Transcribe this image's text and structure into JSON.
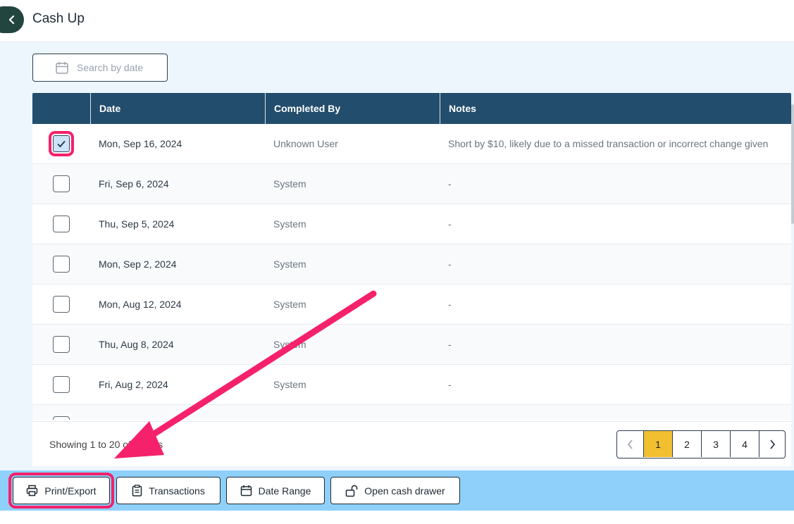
{
  "header": {
    "title": "Cash Up"
  },
  "search": {
    "placeholder": "Search by date"
  },
  "table": {
    "columns": [
      "",
      "Date",
      "Completed By",
      "Notes"
    ],
    "rows": [
      {
        "checked": true,
        "date": "Mon, Sep 16, 2024",
        "completed_by": "Unknown User",
        "notes": "Short by $10, likely due to a missed transaction or incorrect change given"
      },
      {
        "checked": false,
        "date": "Fri, Sep 6, 2024",
        "completed_by": "System",
        "notes": "-"
      },
      {
        "checked": false,
        "date": "Thu, Sep 5, 2024",
        "completed_by": "System",
        "notes": "-"
      },
      {
        "checked": false,
        "date": "Mon, Sep 2, 2024",
        "completed_by": "System",
        "notes": "-"
      },
      {
        "checked": false,
        "date": "Mon, Aug 12, 2024",
        "completed_by": "System",
        "notes": "-"
      },
      {
        "checked": false,
        "date": "Thu, Aug 8, 2024",
        "completed_by": "System",
        "notes": "-"
      },
      {
        "checked": false,
        "date": "Fri, Aug 2, 2024",
        "completed_by": "System",
        "notes": "-"
      },
      {
        "checked": false,
        "date": "",
        "completed_by": "",
        "notes": ""
      }
    ]
  },
  "pagination": {
    "showing_text": "Showing 1 to 20 of results",
    "pages": [
      "1",
      "2",
      "3",
      "4"
    ],
    "active_page": "1"
  },
  "actions": {
    "print_export": "Print/Export",
    "transactions": "Transactions",
    "date_range": "Date Range",
    "open_cash_drawer": "Open cash drawer"
  },
  "colors": {
    "header_bg": "#234d6d",
    "active_page": "#f2bf30",
    "bottom_bar": "#8fd0fb",
    "annotation": "#f5216a"
  }
}
